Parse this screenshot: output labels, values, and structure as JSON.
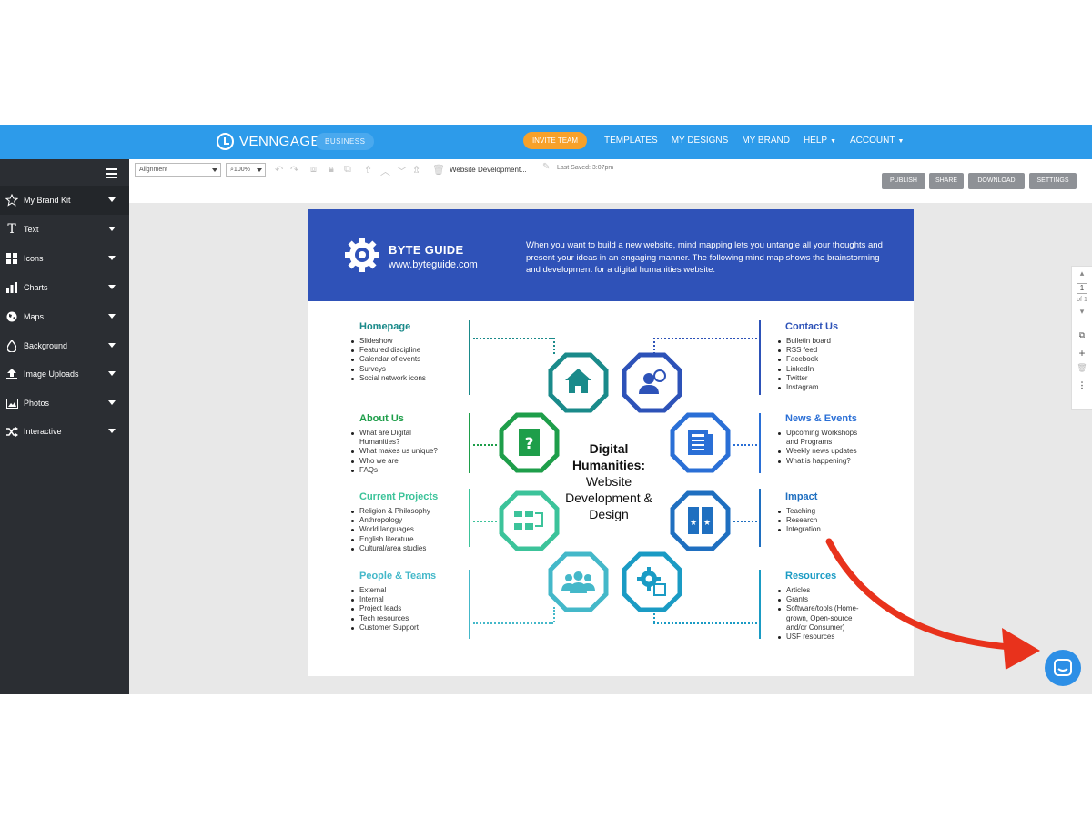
{
  "nav": {
    "brand": "VENNGAGE",
    "plan_badge": "BUSINESS",
    "invite_label": "INVITE TEAM",
    "links": [
      "TEMPLATES",
      "MY DESIGNS",
      "MY BRAND",
      "HELP",
      "ACCOUNT"
    ]
  },
  "sidebar": {
    "items": [
      {
        "label": "My Brand Kit",
        "icon": "star-icon"
      },
      {
        "label": "Text",
        "icon": "text-icon"
      },
      {
        "label": "Icons",
        "icon": "grid-icon"
      },
      {
        "label": "Charts",
        "icon": "bar-chart-icon"
      },
      {
        "label": "Maps",
        "icon": "globe-icon"
      },
      {
        "label": "Background",
        "icon": "droplet-icon"
      },
      {
        "label": "Image Uploads",
        "icon": "upload-icon"
      },
      {
        "label": "Photos",
        "icon": "photo-icon"
      },
      {
        "label": "Interactive",
        "icon": "shuffle-icon"
      }
    ]
  },
  "toolbar": {
    "alignment": "Alignment",
    "zoom": "100%",
    "doc_title": "Website Development...",
    "last_saved": "Last Saved: 3:07pm",
    "buttons": [
      "PUBLISH",
      "SHARE",
      "DOWNLOAD",
      "SETTINGS"
    ]
  },
  "page_panel": {
    "page_number": "1",
    "page_total": "of 1"
  },
  "infographic": {
    "brand": "BYTE GUIDE",
    "url": "www.byteguide.com",
    "intro": "When you want to build a new website, mind mapping lets you untangle all your thoughts and present your ideas in an engaging manner. The following mind map shows the brainstorming and development for a digital humanities website:",
    "center_title": "Digital Humanities:",
    "center_subtitle": "Website Development & Design",
    "left_sections": [
      {
        "title": "Homepage",
        "color": "#1a8a8a",
        "items": [
          "Slideshow",
          "Featured discipline",
          "Calendar of events",
          "Surveys",
          "Social network icons"
        ]
      },
      {
        "title": "About Us",
        "color": "#1e9e4a",
        "items": [
          "What are Digital",
          "Humanities?",
          "What makes us unique?",
          "Who we are",
          "FAQs"
        ]
      },
      {
        "title": "Current Projects",
        "color": "#3cc39a",
        "items": [
          "Religion & Philosophy",
          "Anthropology",
          "World languages",
          "English literature",
          "Cultural/area studies"
        ]
      },
      {
        "title": "People & Teams",
        "color": "#44b8c9",
        "items": [
          "External",
          "Internal",
          "Project leads",
          "Tech resources",
          "Customer Support"
        ]
      }
    ],
    "right_sections": [
      {
        "title": "Contact Us",
        "color": "#2d52b8",
        "items": [
          "Bulletin board",
          "RSS feed",
          "Facebook",
          "LinkedIn",
          "Twitter",
          "Instagram"
        ]
      },
      {
        "title": "News & Events",
        "color": "#2a6fd6",
        "items": [
          "Upcoming Workshops",
          "and Programs",
          "Weekly news updates",
          "What is happening?"
        ]
      },
      {
        "title": "Impact",
        "color": "#1f6fc0",
        "items": [
          "Teaching",
          "Research",
          "Integration"
        ]
      },
      {
        "title": "Resources",
        "color": "#1a9bc4",
        "items": [
          "Articles",
          "Grants",
          "Software/tools (Home-",
          "grown, Open-source",
          "and/or Consumer)",
          "USF resources"
        ]
      }
    ]
  },
  "colors": {
    "nav_blue": "#2d9bea",
    "sidebar_dark": "#2b2e33",
    "banner_blue": "#2f52b8",
    "invite_orange": "#f7a12a",
    "arrow_red": "#e8321c"
  }
}
